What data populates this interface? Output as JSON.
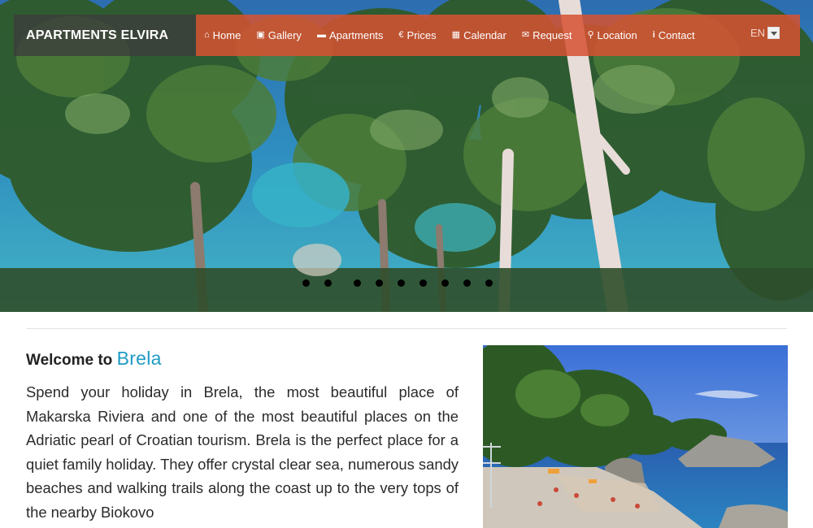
{
  "brand": {
    "name": "APARTMENTS ELVIRA"
  },
  "nav": {
    "items": [
      {
        "icon": "home-icon",
        "label": "Home"
      },
      {
        "icon": "gallery-icon",
        "label": "Gallery"
      },
      {
        "icon": "bed-icon",
        "label": "Apartments"
      },
      {
        "icon": "euro-icon",
        "label": "Prices"
      },
      {
        "icon": "calendar-icon",
        "label": "Calendar"
      },
      {
        "icon": "envelope-icon",
        "label": "Request"
      },
      {
        "icon": "map-marker-icon",
        "label": "Location"
      },
      {
        "icon": "info-icon",
        "label": "Contact"
      }
    ],
    "language": "EN"
  },
  "slider": {
    "slide_count": 9,
    "active_index": 0
  },
  "content": {
    "heading_prefix": "Welcome to",
    "heading_accent": "Brela",
    "paragraph": "Spend your holiday in Brela, the most beautiful place of Makarska Riviera and one of the most beautiful places on the Adriatic pearl of Croatian tourism. Brela is the perfect place for a quiet family holiday. They offer crystal clear sea, numerous sandy beaches and walking trails along the coast up to the very tops of the nearby Biokovo"
  },
  "colors": {
    "navbar": "#d65232",
    "brand_bg": "#3c3c3c",
    "accent": "#1d9bc4",
    "text": "#2b2b2b"
  }
}
